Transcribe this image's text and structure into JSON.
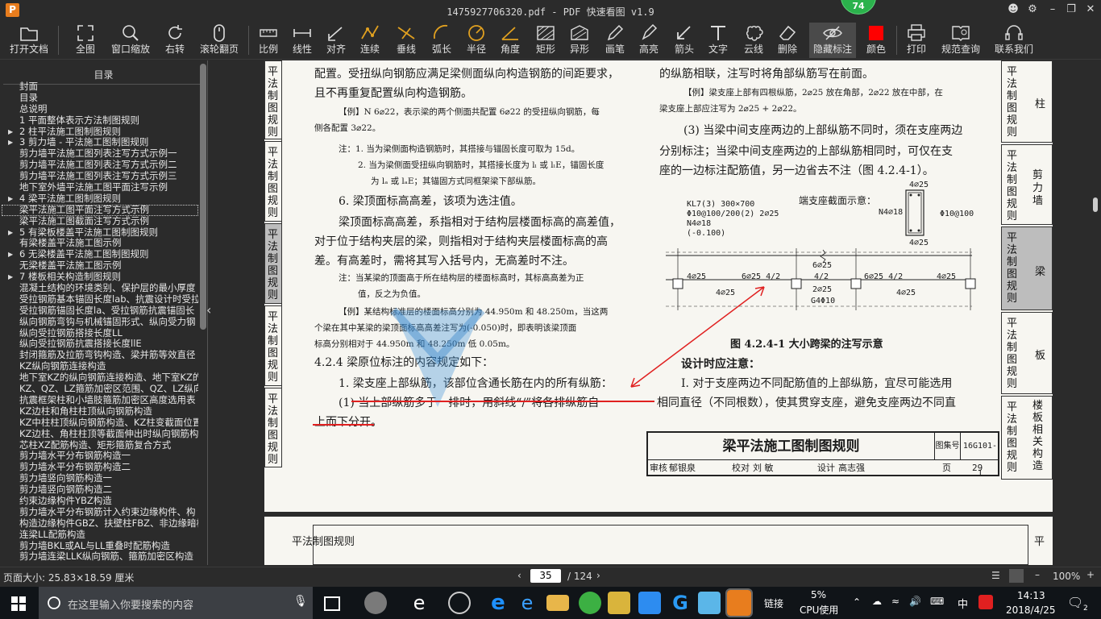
{
  "window": {
    "title": "1475927706320.pdf - PDF 快速看图 v1.9",
    "badge": "74",
    "app_icon_letter": "P"
  },
  "toolbar": {
    "open": "打开文档",
    "full": "全图",
    "zoom_window": "窗口缩放",
    "rotate_right": "右转",
    "wheel_page": "滚轮翻页",
    "scale": "比例",
    "linear": "线性",
    "align": "对齐",
    "continuous": "连续",
    "perpendicular": "垂线",
    "arc_length": "弧长",
    "radius": "半径",
    "angle": "角度",
    "rect": "矩形",
    "irregular": "异形",
    "pen": "画笔",
    "highlight": "高亮",
    "arrow": "箭头",
    "text": "文字",
    "cloud": "云线",
    "delete": "删除",
    "hide_markup": "隐藏标注",
    "color": "颜色",
    "print": "打印",
    "spec_query": "规范查询",
    "contact": "联系我们",
    "color_value": "#ff0000"
  },
  "sidebar": {
    "title": "目录",
    "items": [
      {
        "label": "封面",
        "exp": false
      },
      {
        "label": "目录",
        "exp": false
      },
      {
        "label": "总说明",
        "exp": false
      },
      {
        "label": "1 平面整体表示方法制图规则",
        "exp": false
      },
      {
        "label": "2 柱平法施工图制图规则",
        "exp": true
      },
      {
        "label": "3 剪力墙 - 平法施工图制图规则",
        "exp": true
      },
      {
        "label": "剪力墙平法施工图列表注写方式示例一",
        "exp": false
      },
      {
        "label": "剪力墙平法施工图列表注写方式示例二",
        "exp": false
      },
      {
        "label": "剪力墙平法施工图列表注写方式示例三",
        "exp": false
      },
      {
        "label": "地下室外墙平法施工图平面注写示例",
        "exp": false
      },
      {
        "label": "4 梁平法施工图制图规则",
        "exp": true
      },
      {
        "label": "梁平法施工图平面注写方式示例",
        "exp": false,
        "sel": true
      },
      {
        "label": "梁平法施工图截面注写方式示例",
        "exp": false
      },
      {
        "label": "5 有梁板楼盖平法施工图制图规则",
        "exp": true
      },
      {
        "label": "有梁楼盖平法施工图示例",
        "exp": false
      },
      {
        "label": "6 无梁楼盖平法施工图制图规则",
        "exp": true
      },
      {
        "label": "无梁楼盖平法施工图示例",
        "exp": false
      },
      {
        "label": "7 楼板相关构造制图规则",
        "exp": true
      },
      {
        "label": "混凝土结构的环境类别、保护层的最小厚度",
        "exp": false
      },
      {
        "label": "受拉钢筋基本锚固长度lab、抗震设计时受拉",
        "exp": false
      },
      {
        "label": "受拉钢筋锚固长度la、受拉钢筋抗震锚固长",
        "exp": false
      },
      {
        "label": "纵向钢筋弯钩与机械锚固形式、纵向受力钢",
        "exp": false
      },
      {
        "label": "纵向受拉钢筋搭接长度LL",
        "exp": false
      },
      {
        "label": "纵向受拉钢筋抗震搭接长度llE",
        "exp": false
      },
      {
        "label": "封闭箍筋及拉筋弯钩构造、梁并筋等效直径",
        "exp": false
      },
      {
        "label": "KZ纵向钢筋连接构造",
        "exp": false
      },
      {
        "label": "地下室KZ的纵向钢筋连接构造、地下室KZ的",
        "exp": false
      },
      {
        "label": "KZ、QZ、LZ箍筋加密区范围、QZ、LZ纵向钢",
        "exp": false
      },
      {
        "label": "抗震框架柱和小墙肢箍筋加密区高度选用表",
        "exp": false
      },
      {
        "label": "KZ边柱和角柱柱顶纵向钢筋构造",
        "exp": false
      },
      {
        "label": "KZ中柱柱顶纵向钢筋构造、KZ柱变截面位置",
        "exp": false
      },
      {
        "label": "KZ边柱、角柱柱顶等截面伸出时纵向钢筋构",
        "exp": false
      },
      {
        "label": "芯柱XZ配筋构造、矩形箍筋复合方式",
        "exp": false
      },
      {
        "label": "剪力墙水平分布钢筋构造一",
        "exp": false
      },
      {
        "label": "剪力墙水平分布钢筋构造二",
        "exp": false
      },
      {
        "label": "剪力墙竖向钢筋构造一",
        "exp": false
      },
      {
        "label": "剪力墙竖向钢筋构造二",
        "exp": false
      },
      {
        "label": "约束边缘构件YBZ构造",
        "exp": false
      },
      {
        "label": "剪力墙水平分布钢筋计入约束边缘构件、构",
        "exp": false
      },
      {
        "label": "构造边缘构件GBZ、扶壁柱FBZ、非边缘暗柱",
        "exp": false
      },
      {
        "label": "连梁LL配筋构造",
        "exp": false
      },
      {
        "label": "剪力墙BKL或AL与LL重叠时配筋构造",
        "exp": false
      },
      {
        "label": "剪力墙连梁LLK纵向钢筋、箍筋加密区构造",
        "exp": false
      }
    ]
  },
  "page": {
    "left_col": [
      "配置。受扭纵向钢筋应满足梁侧面纵向构造钢筋的间距要求，",
      "且不再重复配置纵向构造钢筋。",
      "【例】N 6⌀22，表示梁的两个侧面共配置 6⌀22 的受扭纵向钢筋，每",
      "侧各配置 3⌀22。",
      "注：1. 当为梁侧面构造钢筋时，其搭接与锚固长度可取为 15d。",
      "2. 当为梁侧面受扭纵向钢筋时，其搭接长度为 lₗ 或 lₗE，锚固长度",
      "为 lₐ 或 lₐE；其锚固方式同框架梁下部纵筋。",
      "6. 梁顶面标高高差，该项为选注值。",
      "梁顶面标高高差，系指相对于结构层楼面标高的高差值，",
      "对于位于结构夹层的梁，则指相对于结构夹层楼面标高的高",
      "差。有高差时，需将其写入括号内，无高差时不注。",
      "注：当某梁的顶面高于所在结构层的楼面标高时，其标高高差为正",
      "值，反之为负值。",
      "【例】某结构标准层的楼面标高分别为 44.950m 和 48.250m，当这两",
      "个梁在其中某梁的梁顶面标高高差注写为(-0.050)时，即表明该梁顶面",
      "标高分别相对于 44.950m 和 48.250m 低 0.05m。",
      "4.2.4 梁原位标注的内容规定如下：",
      "1. 梁支座上部纵筋，该部位含通长筋在内的所有纵筋：",
      "(1) 当上部纵筋多于一排时，用斜线“/”将各排纵筋自",
      "上而下分开。"
    ],
    "right_col": [
      "的纵筋相联，注写时将角部纵筋写在前面。",
      "【例】梁支座上部有四根纵筋，2⌀25 放在角部，2⌀22 放在中部，在",
      "梁支座上部应注写为 2⌀25 + 2⌀22。",
      "(3) 当梁中间支座两边的上部纵筋不同时，须在支座两边",
      "分别标注；当梁中间支座两边的上部纵筋相同时，可仅在支",
      "座的一边标注配筋值，另一边省去不注（图 4.2.4-1）。"
    ],
    "figure": {
      "caption": "图 4.2.4-1 大小跨梁的注写示意",
      "section_label": "端支座截面示意：",
      "kl_lines": [
        "KL7(3) 300×700",
        "Φ10@100/200(2) 2⌀25",
        "N4⌀18",
        "(-0.100)"
      ],
      "sec_top": "4⌀25",
      "sec_side": "N4⌀18",
      "sec_stirrup": "Φ10@100",
      "sec_bottom": "4⌀25",
      "labels_top": [
        "4⌀25",
        "6⌀25 4/2",
        "6⌀25",
        "4/2",
        "6⌀25 4/2",
        "4⌀25"
      ],
      "labels_bottom": [
        "4⌀25",
        "2⌀25",
        "G4Φ10",
        "4⌀25"
      ]
    },
    "design_note": "设计时应注意：",
    "design_lines": [
      "Ⅰ. 对于支座两边不同配筋值的上部纵筋，宜尽可能选用",
      "相同直径（不同根数），使其贯穿支座，避免支座两边不同直"
    ],
    "titleblock": {
      "title": "梁平法施工图制图规则",
      "atlas_label": "图集号",
      "atlas_no": "16G101-1",
      "review": "审核",
      "reviewer": "郁银泉",
      "check": "校对",
      "checker": "刘 敏",
      "design": "设计",
      "designer": "高志强",
      "page_label": "页",
      "page_no": "29"
    },
    "side_tabs": [
      {
        "text": "平法制图规则",
        "key": "柱"
      },
      {
        "text": "平法制图规则",
        "key": "剪力墙"
      },
      {
        "text": "平法制图规则",
        "key": "梁"
      },
      {
        "text": "平法制图规则",
        "key": "板"
      },
      {
        "text": "平法制图规则",
        "key": "楼板相关构造"
      }
    ],
    "left_tabs": [
      "平法制图规则",
      "平法制图规则",
      "平法制图规则",
      "平法制图规则",
      "平法制图规则"
    ],
    "next_page_tab": "平"
  },
  "status": {
    "page_size": "页面大小: 25.83×18.59 厘米",
    "current_page": "35",
    "total_pages": "/ 124",
    "zoom": "100%"
  },
  "taskbar": {
    "search_placeholder": "在这里输入你要搜索的内容",
    "link_label": "链接",
    "cpu_percent": "5%",
    "cpu_label": "CPU使用",
    "ime": "中",
    "time": "14:13",
    "date": "2018/4/25",
    "notif_count": "2"
  }
}
